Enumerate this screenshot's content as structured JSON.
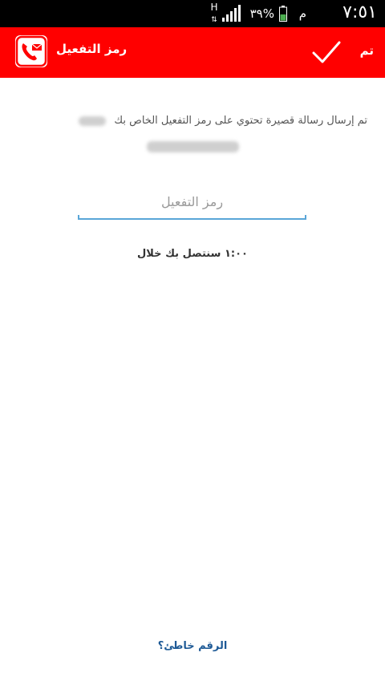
{
  "status_bar": {
    "time": "٧:٥١",
    "ampm": "م",
    "battery": "٣٩%",
    "network": "H",
    "icons": [
      "signal-icon",
      "battery-icon",
      "network-h-icon"
    ]
  },
  "action_bar": {
    "title": "رمز التفعيل",
    "done_label": "تم",
    "background": "#ff0000",
    "icons": [
      "phone-message-icon",
      "check-icon"
    ]
  },
  "main": {
    "instruction": "تم إرسال رسالة قصيرة تحتوي على رمز التفعيل الخاص بك",
    "code_placeholder": "رمز التفعيل",
    "code_value": "",
    "countdown": "١:٠٠ سنتصل بك خلال",
    "wrong_number_link": "الرقم خاطئ؟",
    "underline_color": "#5aa6d8",
    "link_color": "#1e5a96"
  }
}
